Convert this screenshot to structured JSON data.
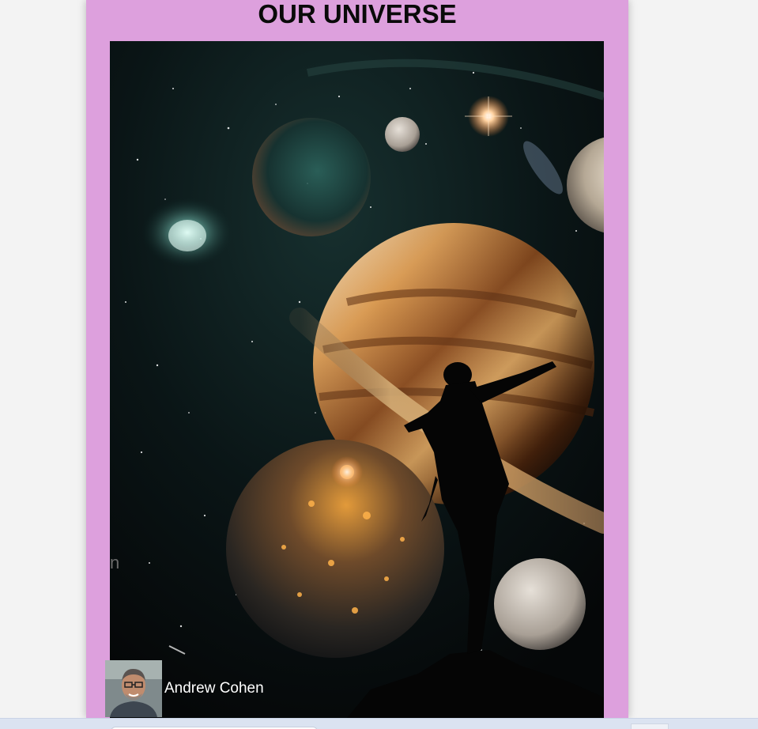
{
  "page": {
    "title": "OUR UNIVERSE"
  },
  "hero_image": {
    "name": "universe-planets-silhouette-image",
    "watermark_text": "n"
  },
  "author": {
    "name": "Andrew Cohen",
    "avatar_icon": "author-avatar-photo"
  },
  "colors": {
    "card_background": "#dda0dd",
    "page_background": "#f3f3f3",
    "title_color": "#0a0a0a",
    "author_name_color": "#ffffff"
  }
}
